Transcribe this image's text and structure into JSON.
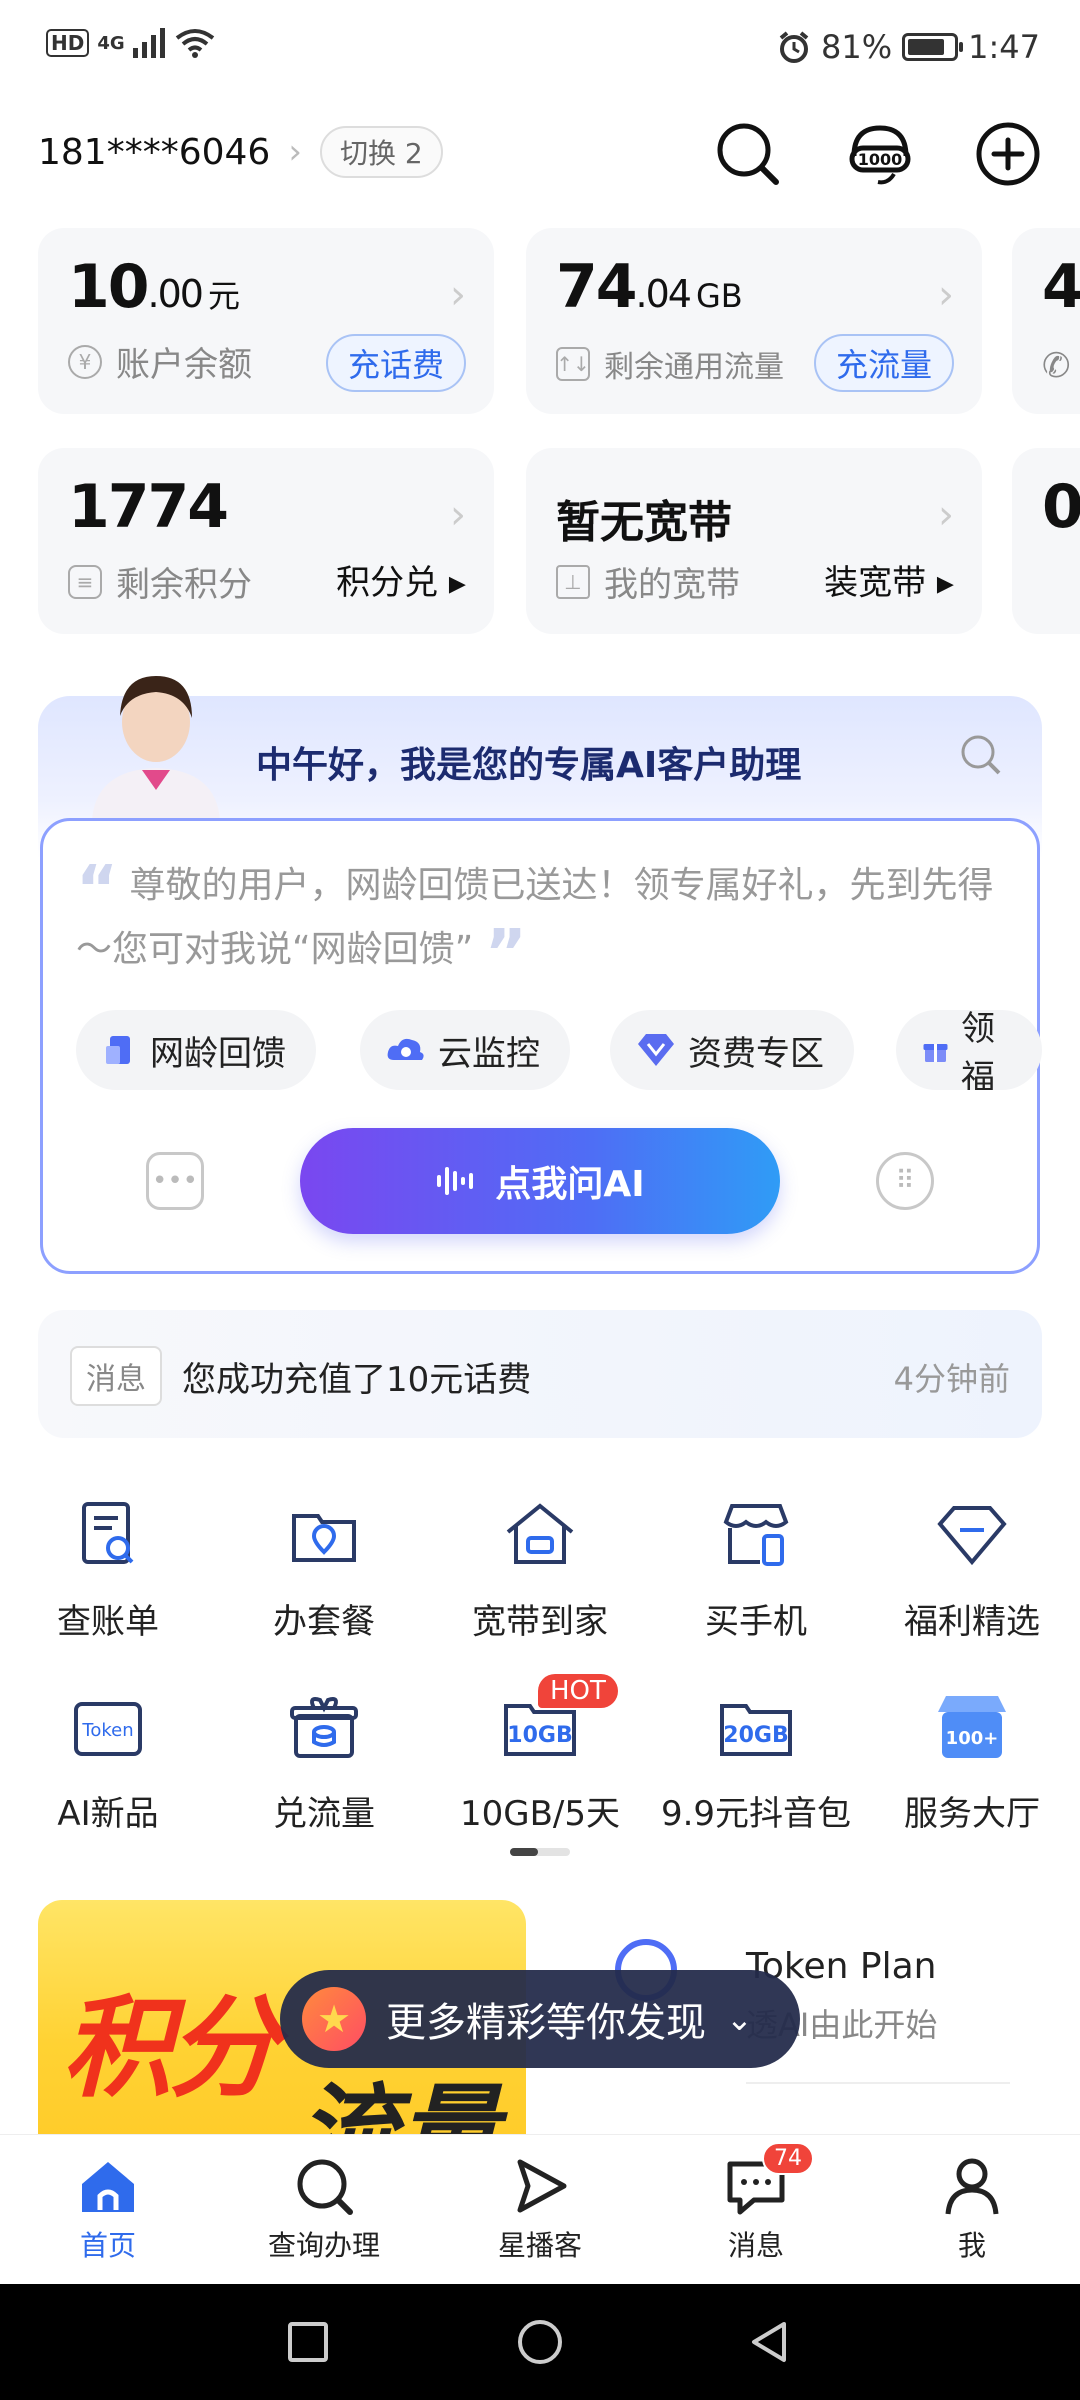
{
  "status_bar": {
    "hd": "HD",
    "network": "4G",
    "battery_text": "81%",
    "battery_level": 0.81,
    "time": "1:47"
  },
  "header": {
    "account": "181****6046",
    "switch_label": "切换 2"
  },
  "cards": {
    "balance": {
      "int": "10",
      "dec": ".00",
      "unit": "元",
      "label": "账户余额",
      "action": "充话费"
    },
    "data": {
      "int": "74",
      "dec": ".04",
      "unit": "GB",
      "label": "剩余通用流量",
      "action": "充流量"
    },
    "partial_top": "4",
    "points": {
      "value": "1774",
      "label": "剩余积分",
      "action": "积分兑 ▸"
    },
    "broadband": {
      "value": "暂无宽带",
      "label": "我的宽带",
      "action": "装宽带 ▸"
    },
    "partial_bottom": "0."
  },
  "ai": {
    "greeting": "中午好，我是您的专属AI客户助理",
    "message": "尊敬的用户，网龄回馈已送达！领专属好礼，先到先得～您可对我说“网龄回馈”",
    "chips": [
      "网龄回馈",
      "云监控",
      "资费专区",
      "领福"
    ],
    "button": "点我问AI"
  },
  "message_bar": {
    "tag": "消息",
    "text": "您成功充值了10元话费",
    "time": "4分钟前"
  },
  "grid": {
    "row1": [
      "查账单",
      "办套餐",
      "宽带到家",
      "买手机",
      "福利精选"
    ],
    "row2": [
      "AI新品",
      "兑流量",
      "10GB/5天",
      "9.9元抖音包",
      "服务大厅"
    ],
    "hot": "HOT",
    "icon_text": {
      "token": "Token",
      "10gb": "10GB",
      "20gb": "20GB",
      "100": "100+"
    }
  },
  "promo": {
    "left_text1": "积分",
    "left_text2": "流量",
    "right_title": "Token Plan",
    "right_sub": "透AI由此开始",
    "discover": "更多精彩等你发现"
  },
  "tabs": [
    "首页",
    "查询办理",
    "星播客",
    "消息",
    "我"
  ],
  "message_badge": "74",
  "colors": {
    "accent": "#2f6bec",
    "ai_gradient_start": "#7a47f0",
    "ai_gradient_end": "#2f9cf6",
    "hot": "#f0443a"
  }
}
